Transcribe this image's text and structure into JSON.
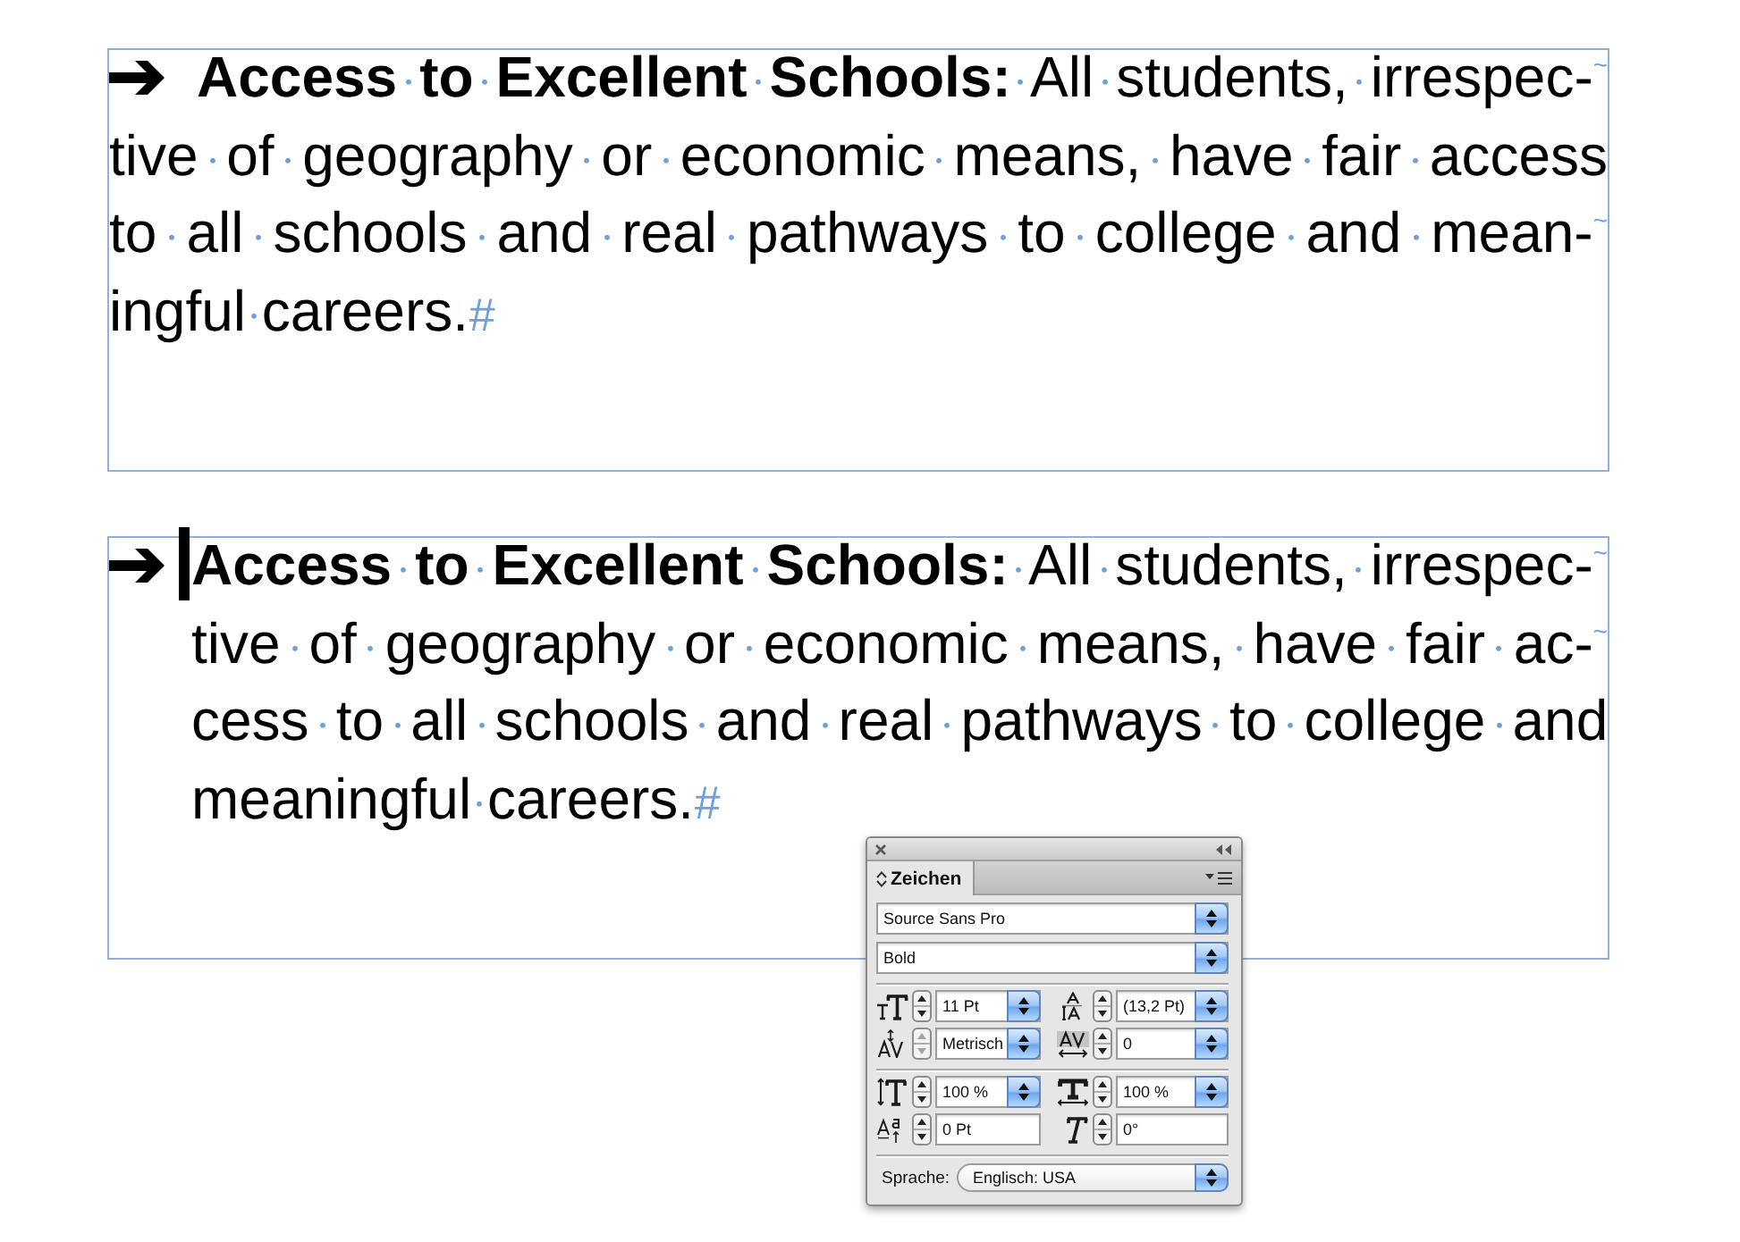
{
  "text_frames": [
    {
      "hanging_indent": false,
      "text_cursor": false,
      "lines": [
        {
          "text": "**Access to Excellent Schools:** All students, irrespec-",
          "end_mark": "~"
        },
        {
          "text": "tive of geography or economic means, have fair access"
        },
        {
          "text": "to all schools and real pathways to college and mean-",
          "end_mark": "~"
        },
        {
          "text": "ingful careers."
        }
      ],
      "paragraph_end_mark": "#"
    },
    {
      "hanging_indent": true,
      "text_cursor": true,
      "lines": [
        {
          "text": "**Access to Excellent Schools:** All students, irrespec-",
          "end_mark": "~"
        },
        {
          "text": "tive of geography or economic means, have fair ac-",
          "end_mark": "~"
        },
        {
          "text": "cess to all schools and real pathways to college and"
        },
        {
          "text": "meaningful careers."
        }
      ],
      "paragraph_end_mark": "#"
    }
  ],
  "character_panel": {
    "tabs": [
      {
        "label": "Zeichen",
        "selected": true
      }
    ],
    "font_family": "Source Sans Pro",
    "font_style": "Bold",
    "groups": [
      [
        {
          "kind": "font-size",
          "value": "11 Pt",
          "dropdown": true,
          "stepper_disabled": false
        },
        {
          "kind": "leading",
          "value": "(13,2 Pt)",
          "dropdown": true,
          "stepper_disabled": false
        },
        {
          "kind": "kerning",
          "value": "Metrisch",
          "dropdown": true,
          "stepper_disabled": true
        },
        {
          "kind": "tracking",
          "value": "0",
          "dropdown": true,
          "stepper_disabled": false
        }
      ],
      [
        {
          "kind": "vertical-scale",
          "value": "100 %",
          "dropdown": true,
          "stepper_disabled": false
        },
        {
          "kind": "horizontal-scale",
          "value": "100 %",
          "dropdown": true,
          "stepper_disabled": false
        },
        {
          "kind": "baseline-shift",
          "value": "0 Pt",
          "dropdown": false,
          "stepper_disabled": false
        },
        {
          "kind": "skew",
          "value": "0°",
          "dropdown": false,
          "stepper_disabled": false
        }
      ]
    ],
    "language": {
      "label": "Sprache:",
      "value": "Englisch: USA"
    }
  }
}
